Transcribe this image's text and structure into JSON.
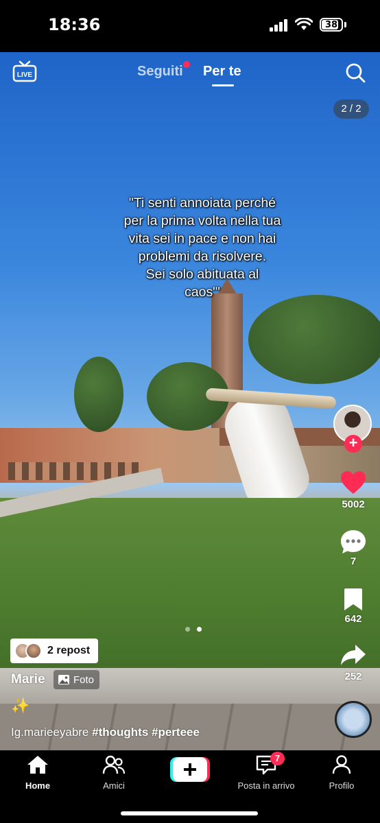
{
  "status_bar": {
    "time": "18:36",
    "battery": "38"
  },
  "top_nav": {
    "tabs": [
      {
        "label": "Seguiti",
        "active": false,
        "has_dot": true
      },
      {
        "label": "Per te",
        "active": true
      }
    ],
    "live_icon": "live-tv-icon",
    "search_icon": "search-icon"
  },
  "page_counter": "2 / 2",
  "caption": "\"Ti senti annoiata perché\nper la prima volta nella tua\nvita sei in  pace e non hai\nproblemi da risolvere.\nSei solo abituata al\ncaos\"'",
  "rail": {
    "likes": "5002",
    "comments": "7",
    "saves": "642",
    "shares": "252"
  },
  "carousel": {
    "total": 2,
    "current": 2
  },
  "post": {
    "repost_label": "2 repost",
    "author": "Marie",
    "photo_tag": "Foto",
    "emoji": "✨",
    "handle": "Ig.marieeyabre",
    "hashtags": "#thoughts #perteee"
  },
  "bottom_nav": {
    "home": "Home",
    "friends": "Amici",
    "inbox": "Posta in arrivo",
    "inbox_badge": "7",
    "profile": "Profilo"
  },
  "colors": {
    "accent": "#fe2c55",
    "create_cyan": "#25f4ee"
  }
}
